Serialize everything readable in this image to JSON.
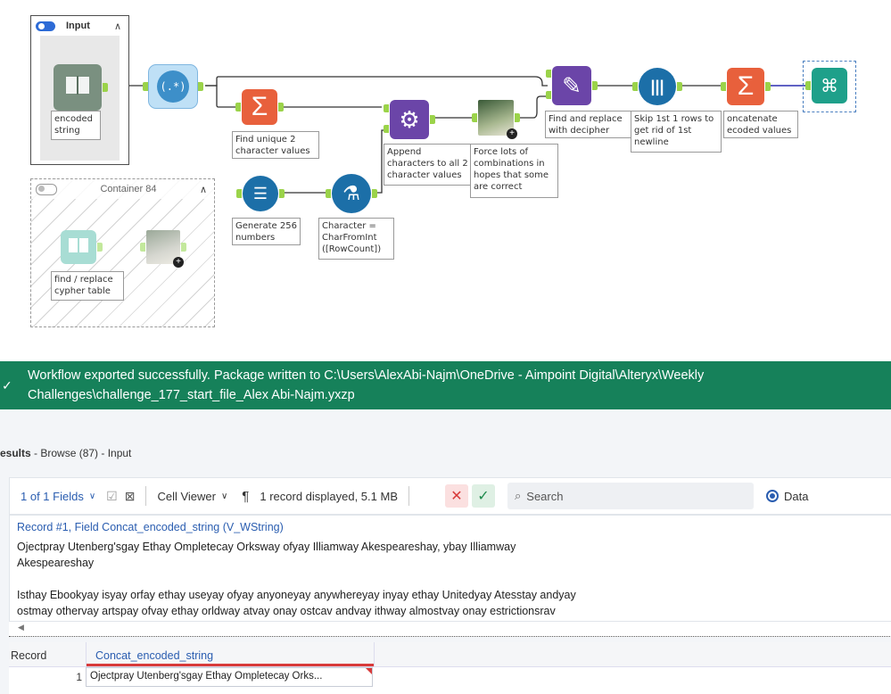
{
  "workflow": {
    "containers": {
      "input": {
        "title": "Input"
      },
      "c84": {
        "title": "Container 84"
      }
    },
    "notes": {
      "encoded_string": "encoded\nstring",
      "find_unique": "Find unique 2\ncharacter values",
      "generate_256": "Generate 256\nnumbers",
      "char_formula": "Character =\nCharFromInt\n([RowCount])",
      "append_chars": "Append\ncharacters to all 2\ncharacter values",
      "force_combos": "Force lots of\ncombinations in\nhopes that some\nare correct",
      "find_replace": "Find and replace\nwith decipher",
      "skip_rows": "Skip 1st 1 rows to\nget rid of 1st\nnewline",
      "concatenate": "oncatenate\necoded values",
      "cypher_table": "find / replace\ncypher table"
    }
  },
  "status": {
    "message": "Workflow exported successfully. Package written to C:\\Users\\AlexAbi-Najm\\OneDrive - Aimpoint Digital\\Alteryx\\Weekly Challenges\\challenge_177_start_file_Alex Abi-Najm.yxzp"
  },
  "results": {
    "title_bold": "esults",
    "title_rest": " - Browse (87) - Input",
    "fields_label": "1 of 1 Fields",
    "cell_viewer_label": "Cell Viewer",
    "pilcrow": "¶",
    "records_info": "1 record displayed, 5.1 MB",
    "search_placeholder": "Search",
    "data_label": "Data",
    "record_header": "Record #1, Field Concat_encoded_string (V_WString)",
    "record_text_1": "Ojectpray Utenberg'sgay Ethay Ompletecay Orksway ofyay Illiamway Akespeareshay, ybay Illiamway",
    "record_text_2": "Akespeareshay",
    "record_text_3": "Isthay Ebookyay isyay orfay ethay useyay ofyay anyoneyay anywhereyay inyay ethay Unitedyay Atesstay andyay",
    "record_text_4": "ostmay othervay artspay ofvay ethay orldway atvay onay ostcav andvay ithway almostvay onay estrictionsrav",
    "grid": {
      "col_record": "Record",
      "col_field": "Concat_encoded_string",
      "row_num": "1",
      "row_value": "Ojectpray Utenberg'sgay Ethay Ompletecay Orks..."
    }
  }
}
